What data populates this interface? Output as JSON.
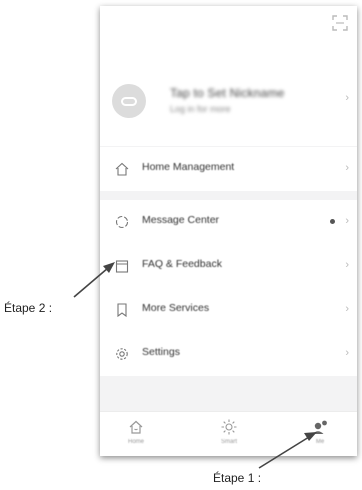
{
  "header": {
    "login_prompt": "Tap to Set Nickname",
    "login_subtitle": "Log in for more"
  },
  "menu": {
    "group1": [
      {
        "label": "Home Management",
        "icon": "house-icon"
      }
    ],
    "group2": [
      {
        "label": "Message Center",
        "icon": "bell-icon",
        "has_dot": true
      },
      {
        "label": "FAQ & Feedback",
        "icon": "calendar-icon"
      },
      {
        "label": "More Services",
        "icon": "bookmark-icon"
      }
    ],
    "group3": [
      {
        "label": "Settings",
        "icon": "gear-icon"
      }
    ]
  },
  "tabs": [
    {
      "label": "Home",
      "icon": "home-tab-icon"
    },
    {
      "label": "Smart",
      "icon": "smart-tab-icon"
    },
    {
      "label": "Me",
      "icon": "me-tab-icon",
      "active": true
    }
  ],
  "annotations": {
    "step2": "Étape 2 :",
    "step1": "Étape 1 :"
  }
}
